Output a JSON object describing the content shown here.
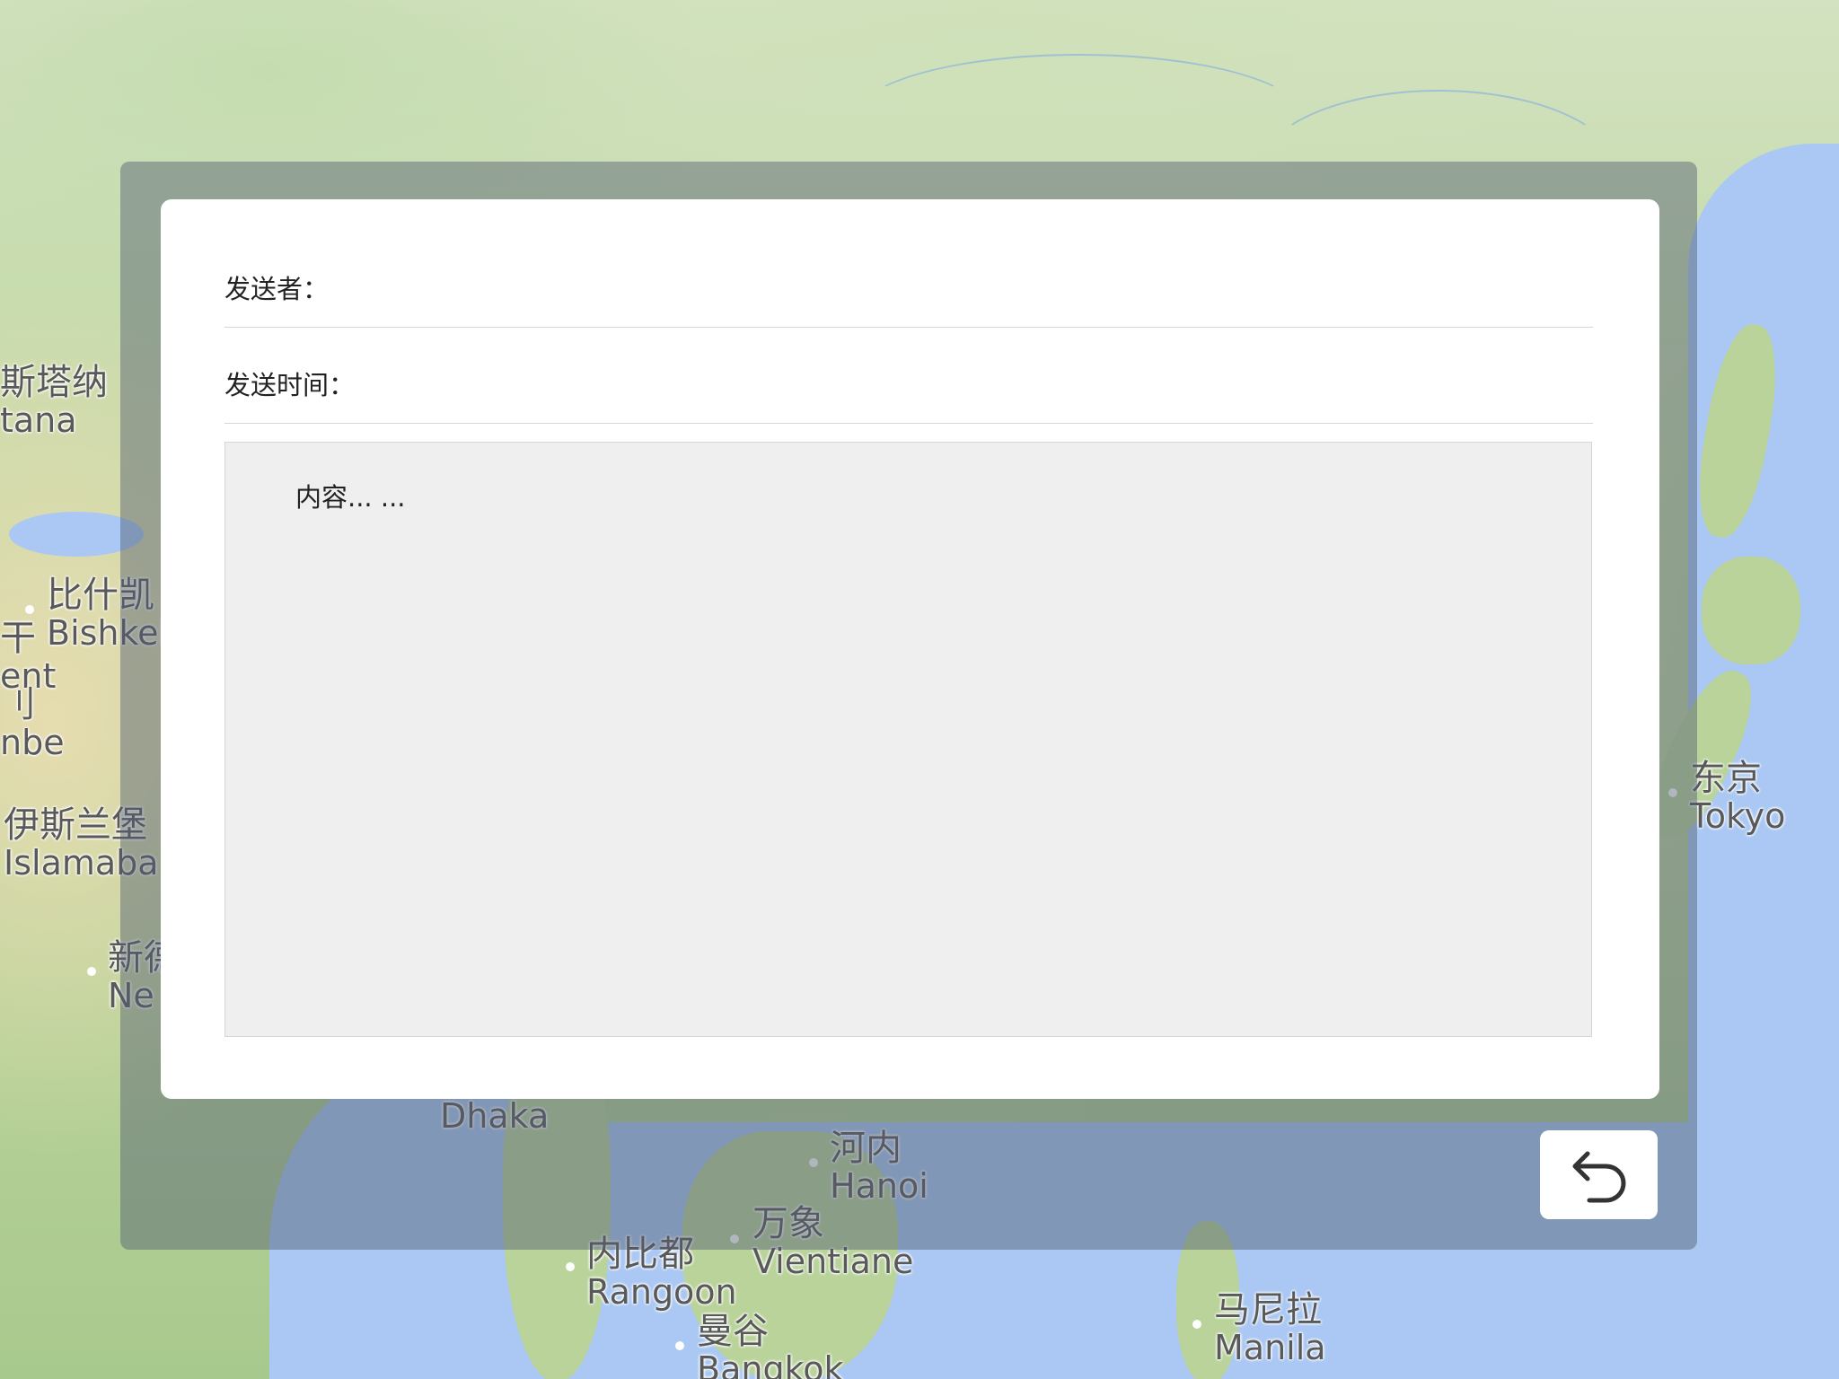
{
  "map": {
    "labels": [
      {
        "id": "astana",
        "zh": "斯塔纳",
        "en": "tana"
      },
      {
        "id": "bishkek",
        "zh": "比什凯",
        "en": "Bishkek"
      },
      {
        "id": "tashkent",
        "zh": "干",
        "en": "ent"
      },
      {
        "id": "dushanbe",
        "zh": "刂",
        "en": "nbe"
      },
      {
        "id": "islamabad",
        "zh": "伊斯兰堡",
        "en": "Islamaba"
      },
      {
        "id": "new-delhi",
        "zh": "新德",
        "en": "Ne"
      },
      {
        "id": "dhaka",
        "zh": "",
        "en": "Dhaka"
      },
      {
        "id": "hanoi",
        "zh": "河内",
        "en": "Hanoi"
      },
      {
        "id": "vientiane",
        "zh": "万象",
        "en": "Vientiane"
      },
      {
        "id": "rangoon",
        "zh": "内比都",
        "en": "Rangoon"
      },
      {
        "id": "bangkok",
        "zh": "曼谷",
        "en": "Bangkok"
      },
      {
        "id": "manila",
        "zh": "马尼拉",
        "en": "Manila"
      },
      {
        "id": "tokyo",
        "zh": "东京",
        "en": "Tokyo"
      }
    ]
  },
  "dialog": {
    "sender_label": "发送者：",
    "sender_value": "",
    "time_label": "发送时间：",
    "time_value": "",
    "content_text": "内容... ..."
  },
  "back_button": {
    "icon": "undo-arrow-icon"
  }
}
